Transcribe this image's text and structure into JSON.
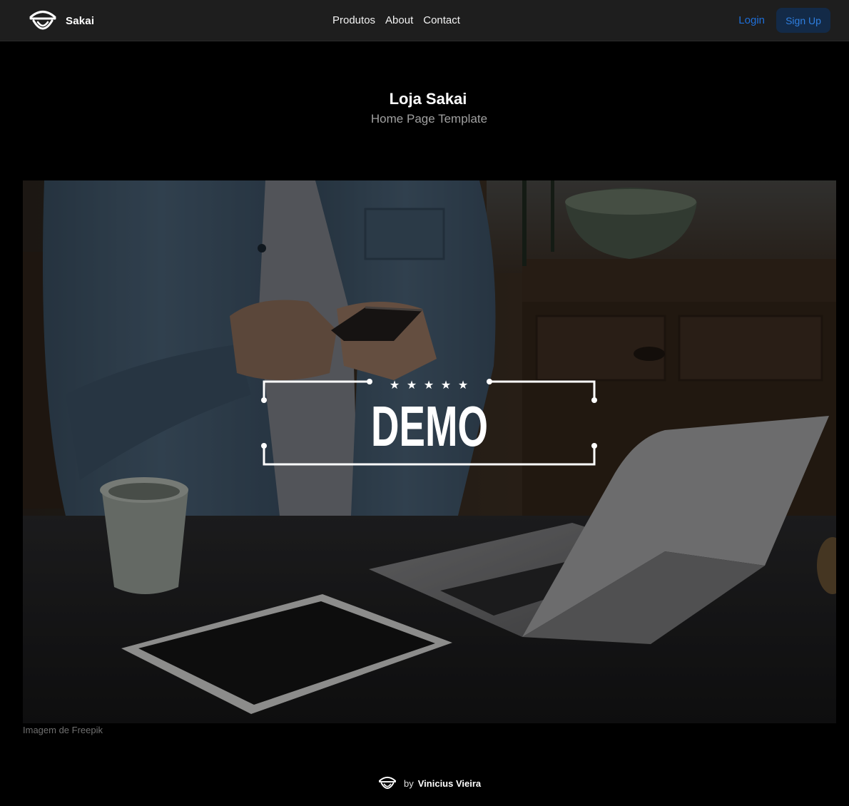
{
  "header": {
    "brand_name": "Sakai",
    "nav": [
      {
        "label": "Produtos"
      },
      {
        "label": "About"
      },
      {
        "label": "Contact"
      }
    ],
    "login_label": "Login",
    "signup_label": "Sign Up"
  },
  "hero": {
    "title": "Loja Sakai",
    "subtitle": "Home Page Template",
    "image_overlay_text": "DEMO",
    "image_caption": "Imagem de Freepik"
  },
  "footer": {
    "by_label": "by",
    "author": "Vinicius Vieira"
  },
  "colors": {
    "topbar_bg": "#1e1e1e",
    "page_bg": "#000000",
    "accent": "#1e6fd9",
    "signup_bg": "#132a47"
  },
  "icons": {
    "logo": "sakai-logo-icon",
    "stars": "star-icon"
  }
}
